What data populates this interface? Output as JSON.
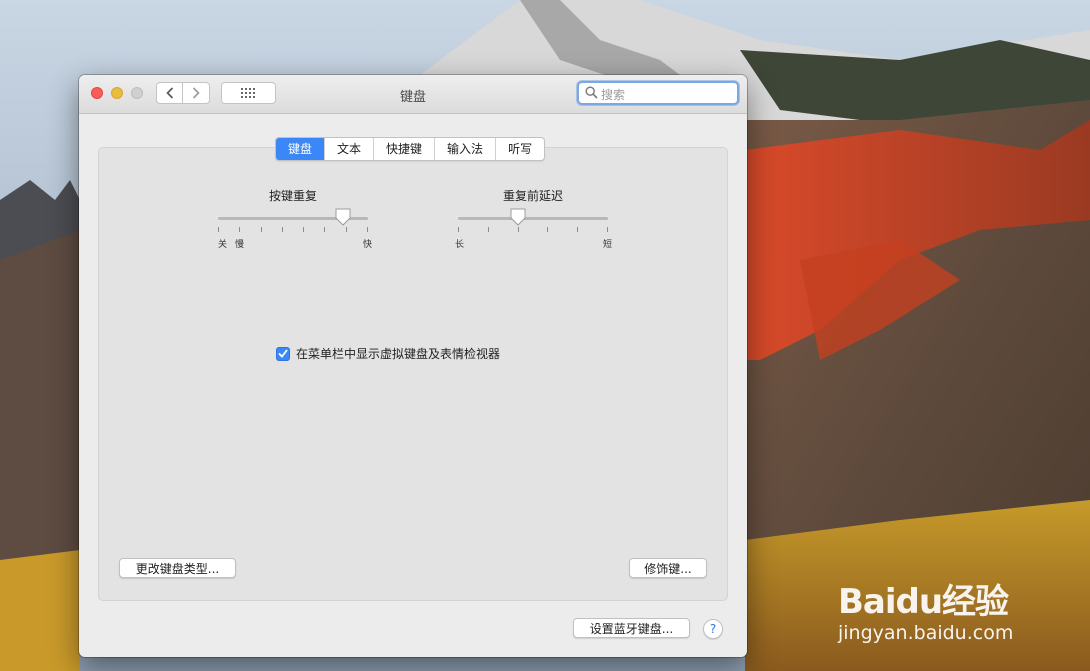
{
  "window": {
    "title": "键盘",
    "search_placeholder": "搜索"
  },
  "tabs": [
    {
      "label": "键盘",
      "active": true
    },
    {
      "label": "文本",
      "active": false
    },
    {
      "label": "快捷键",
      "active": false
    },
    {
      "label": "输入法",
      "active": false
    },
    {
      "label": "听写",
      "active": false
    }
  ],
  "key_repeat": {
    "title": "按键重复",
    "min_label": "关",
    "slow_label": "慢",
    "max_label": "快",
    "value_fraction": 0.83
  },
  "delay_until_repeat": {
    "title": "重复前延迟",
    "min_label": "长",
    "max_label": "短",
    "value_fraction": 0.4
  },
  "show_viewer_checkbox": {
    "label": "在菜单栏中显示虚拟键盘及表情检视器",
    "checked": true
  },
  "buttons": {
    "change_keyboard_type": "更改键盘类型...",
    "modifier_keys": "修饰键...",
    "bluetooth_keyboard": "设置蓝牙键盘...",
    "help": "?"
  },
  "watermark": {
    "brand": "Baidu经验",
    "url": "jingyan.baidu.com"
  }
}
